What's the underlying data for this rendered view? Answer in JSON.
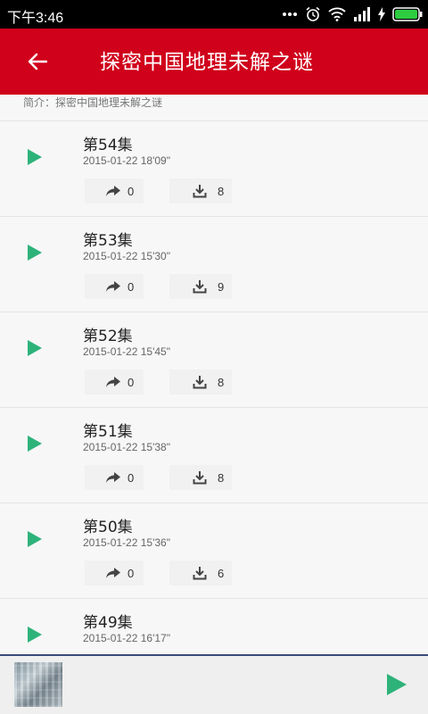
{
  "status_bar": {
    "time": "下午3:46",
    "icons": [
      "more-icon",
      "alarm-icon",
      "wifi-icon",
      "signal-icon",
      "charging-icon",
      "battery-icon"
    ],
    "battery_color": "#2ecc40"
  },
  "app_bar": {
    "title": "探密中国地理未解之谜",
    "back_icon": "back-arrow-icon",
    "background": "#d0011b"
  },
  "intro": {
    "text": "简介：探密中国地理未解之谜"
  },
  "episodes": [
    {
      "name": "第54集",
      "date": "2015-01-22  18'09\"",
      "shares": "0",
      "downloads": "8"
    },
    {
      "name": "第53集",
      "date": "2015-01-22  15'30\"",
      "shares": "0",
      "downloads": "9"
    },
    {
      "name": "第52集",
      "date": "2015-01-22  15'45\"",
      "shares": "0",
      "downloads": "8"
    },
    {
      "name": "第51集",
      "date": "2015-01-22  15'38\"",
      "shares": "0",
      "downloads": "8"
    },
    {
      "name": "第50集",
      "date": "2015-01-22  15'36\"",
      "shares": "0",
      "downloads": "6"
    },
    {
      "name": "第49集",
      "date": "2015-01-22  16'17\"",
      "shares": "",
      "downloads": ""
    }
  ],
  "player": {
    "play_icon": "play-icon",
    "accent": "#2db37a"
  }
}
